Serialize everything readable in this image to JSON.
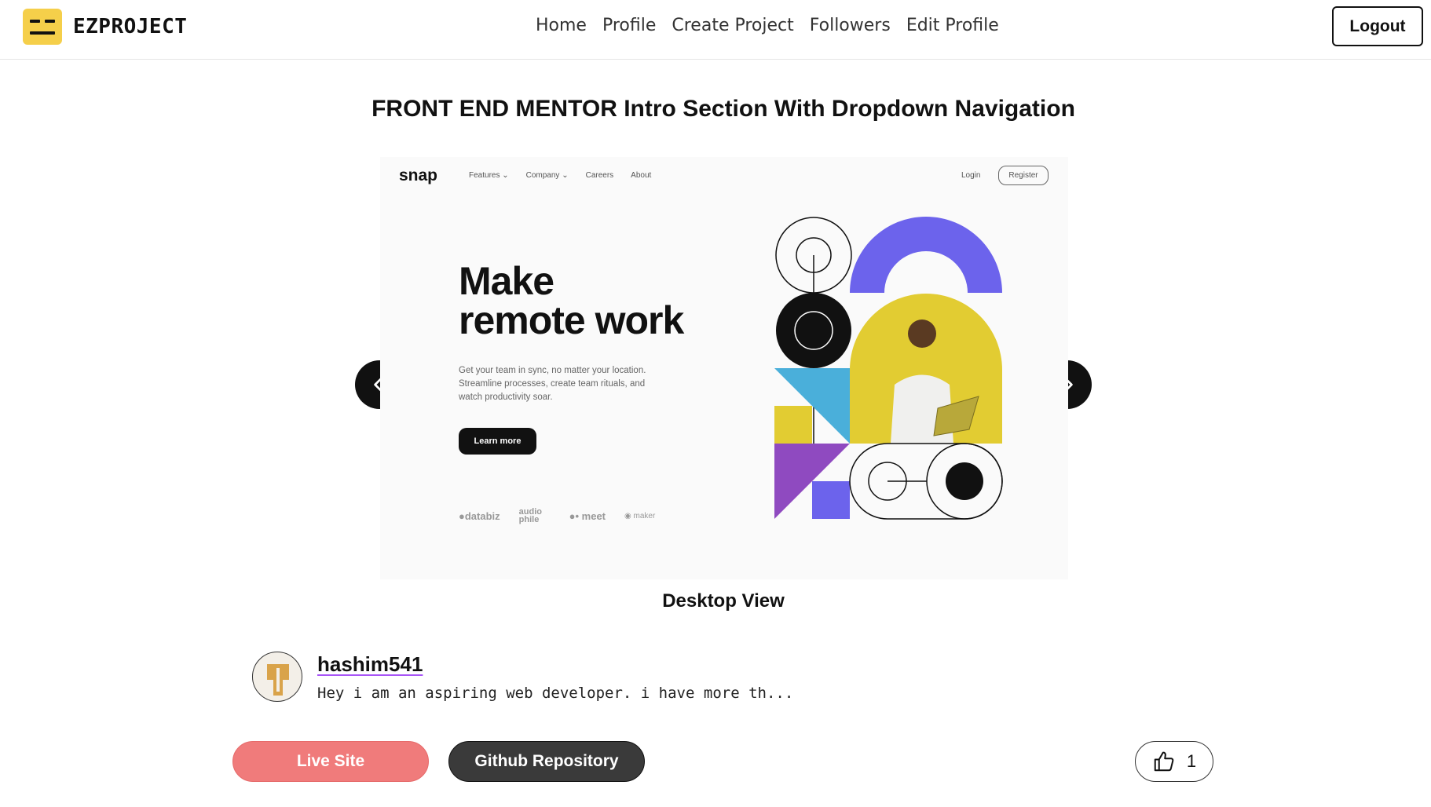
{
  "app": {
    "brand": "EZPROJECT",
    "nav": [
      "Home",
      "Profile",
      "Create Project",
      "Followers",
      "Edit Profile"
    ],
    "logout_label": "Logout"
  },
  "project": {
    "title": "FRONT END MENTOR Intro Section With Dropdown Navigation",
    "caption": "Desktop View",
    "preview": {
      "logo": "snap",
      "nav": [
        "Features ⌄",
        "Company ⌄",
        "Careers",
        "About"
      ],
      "login": "Login",
      "register": "Register",
      "headline_line1": "Make",
      "headline_line2": "remote work",
      "text": "Get your team in sync, no matter your location. Streamline processes, create team rituals, and watch productivity soar.",
      "button": "Learn more",
      "clients": [
        "●databiz",
        "audio phile",
        "●• meet",
        "◉ maker"
      ]
    }
  },
  "author": {
    "name": "hashim541",
    "bio": "Hey i am an aspiring web developer. i have more th..."
  },
  "actions": {
    "live_label": "Live Site",
    "github_label": "Github Repository",
    "like_count": "1"
  },
  "colors": {
    "brand_yellow": "#f5cf4a",
    "live_button": "#f07b7b",
    "github_button": "#3a3a3a",
    "preview_purple": "#6c63ec",
    "preview_yellow": "#e2cc32",
    "preview_blue": "#4aafda"
  }
}
